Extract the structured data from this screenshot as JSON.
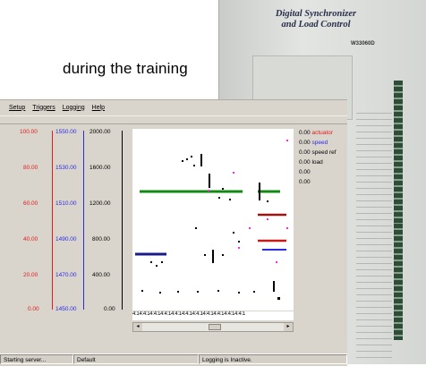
{
  "caption": "during the training",
  "device": {
    "label_line1": "Digital Synchronizer",
    "label_line2": "and Load Control",
    "model": "W33060D"
  },
  "menu": [
    "Setup",
    "Triggers",
    "Logging",
    "Help"
  ],
  "axes": {
    "red_ticks": [
      "100.00",
      "80.00",
      "60.00",
      "40.00",
      "20.00",
      "0.00"
    ],
    "blue_ticks": [
      "1550.00",
      "1530.00",
      "1510.00",
      "1490.00",
      "1470.00",
      "1450.00"
    ],
    "black_ticks": [
      "2000.00",
      "1600.00",
      "1200.00",
      "800.00",
      "400.00",
      "0.00"
    ]
  },
  "legend": [
    {
      "value": "0.00",
      "label": "actuator",
      "color": "#e31b1b"
    },
    {
      "value": "0.00",
      "label": "speed",
      "color": "#2a2ae8"
    },
    {
      "value": "0.00",
      "label": "speed ref",
      "color": "#000000"
    },
    {
      "value": "0.00",
      "label": "load",
      "color": "#000000"
    },
    {
      "value": "0.00",
      "label": "",
      "color": "#000000"
    },
    {
      "value": "0.00",
      "label": "",
      "color": "#000000"
    }
  ],
  "xaxis_text": "4:14:4:14:4:14:4:14:4:14:4:14:4:14:4:14:4:14:4:14:4:1",
  "status": {
    "left": "Starting server...",
    "middle": "Default",
    "right": "Logging is Inactive."
  },
  "colors": {
    "red_axis": "#e31b1b",
    "blue_axis": "#2a2ae8",
    "green_trace": "#128a12",
    "navy_trace": "#1a1a8c",
    "darkred_trace": "#a01010",
    "magenta_points": "#ff2ad4"
  }
}
